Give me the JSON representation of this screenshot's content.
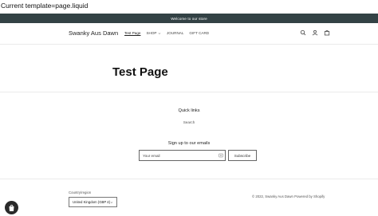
{
  "template_note": "Current template=page.liquid",
  "announcement": {
    "text": "Welcome to our store"
  },
  "header": {
    "brand": "Swanky Aus Dawn",
    "nav": [
      {
        "label": "Test Page",
        "active": true
      },
      {
        "label": "SHOP",
        "has_dropdown": true
      },
      {
        "label": "JOURNAL"
      },
      {
        "label": "GIFT CARD"
      }
    ],
    "icons": [
      "search-icon",
      "account-icon",
      "cart-icon"
    ]
  },
  "main": {
    "title": "Test Page"
  },
  "footer": {
    "quick_links_heading": "Quick links",
    "quick_links": [
      {
        "label": "Search"
      }
    ],
    "newsletter_heading": "Sign up to our emails",
    "email_placeholder": "Your email",
    "subscribe_label": "Subscribe",
    "country_label": "Country/region",
    "country_value": "United Kingdom (GBP £)",
    "copyright": "© 2022, Swanky Aus Dawn Powered by Shopify"
  },
  "colors": {
    "announcement_bg": "#334245",
    "text": "#222222",
    "border": "#666666"
  }
}
